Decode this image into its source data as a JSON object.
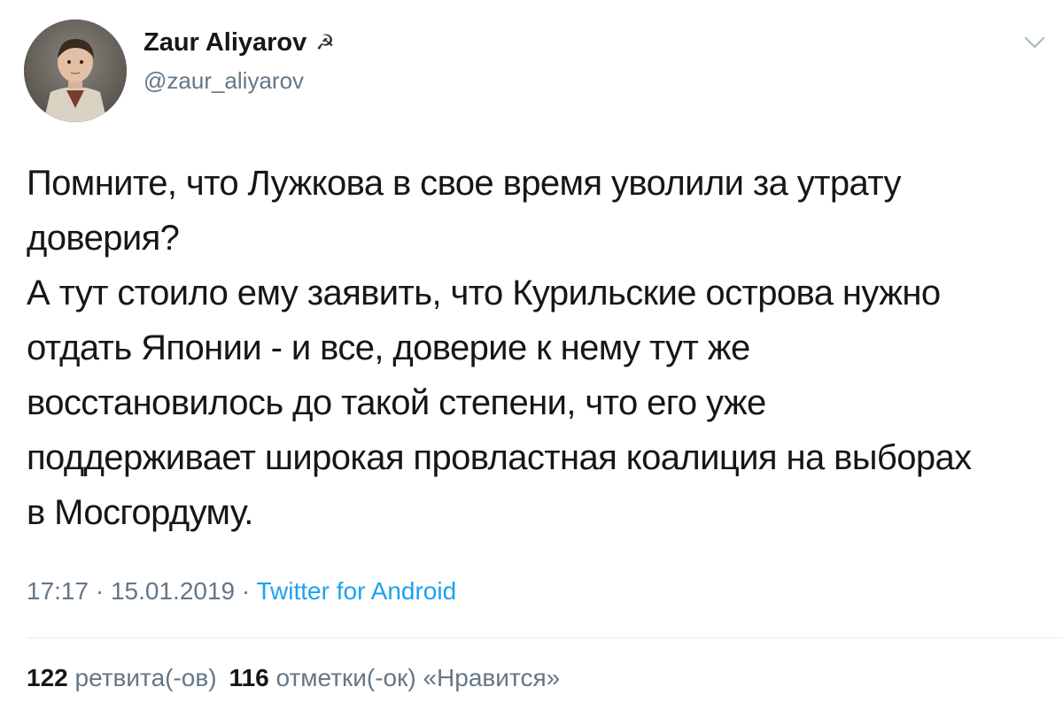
{
  "author": {
    "name": "Zaur Aliyarov",
    "emoji": "☭",
    "handle": "@zaur_aliyarov"
  },
  "tweet": {
    "text": "Помните, что Лужкова в свое время уволили за утрату\nдоверия?\nА тут стоило ему заявить, что Курильские острова нужно\nотдать Японии - и все, доверие к нему тут же\nвосстановилось до такой степени, что его уже\nподдерживает широкая провластная коалиция на выборах\nв Мосгордуму.",
    "time": "17:17",
    "date": "15.01.2019",
    "source": "Twitter for Android",
    "separator": "·"
  },
  "stats": {
    "retweets_count": "122",
    "retweets_label": "ретвита(-ов)",
    "likes_count": "116",
    "likes_label": "отметки(-ок) «Нравится»"
  },
  "icons": {
    "menu": "chevron-down-icon"
  },
  "colors": {
    "text": "#14171a",
    "secondary": "#657786",
    "link": "#1da1f2",
    "divider": "#e1e8ed"
  }
}
